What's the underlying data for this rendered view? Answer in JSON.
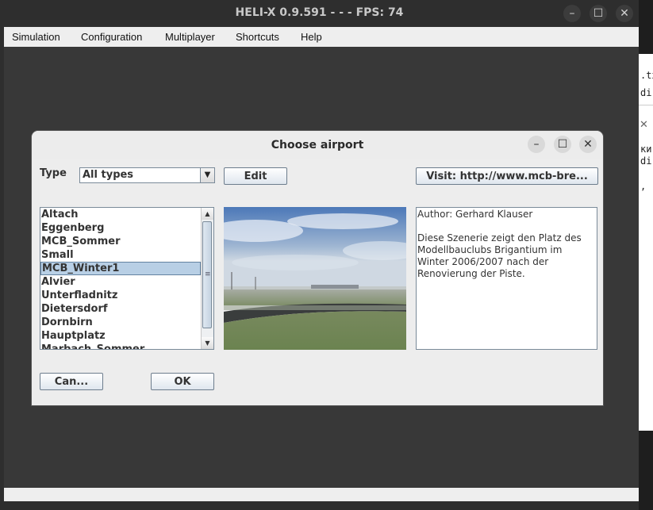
{
  "window": {
    "title": "HELI-X 0.9.591 -  -  - FPS: 74"
  },
  "menubar": [
    "Simulation",
    "Configuration",
    "Multiplayer",
    "Shortcuts",
    "Help"
  ],
  "background_app": {
    "lines": [
      ".txt",
      "di",
      "ки",
      "di",
      ","
    ]
  },
  "dialog": {
    "title": "Choose airport",
    "type_label": "Type",
    "type_value": "All types",
    "edit_label": "Edit",
    "visit_label": "Visit: http://www.mcb-bre...",
    "airports": [
      "Altach",
      "Eggenberg",
      "MCB_Sommer",
      "Small",
      "MCB_Winter1",
      "Alvier",
      "Unterfladnitz",
      "Dietersdorf",
      "Dornbirn",
      "Hauptplatz",
      "Marbach_Sommer"
    ],
    "selected_airport": "MCB_Winter1",
    "author": "Author: Gerhard Klauser",
    "description": "Diese Szenerie zeigt den Platz des Modellbauclubs Brigantium im Winter 2006/2007 nach der Renovierung der Piste.",
    "cancel_label": "Can...",
    "ok_label": "OK"
  },
  "icons": {
    "minimize": "minimize-icon",
    "maximize": "maximize-icon",
    "close": "close-icon",
    "dropdown": "triangle-down-icon",
    "scroll_up": "triangle-up-icon",
    "scroll_down": "triangle-down-icon"
  }
}
